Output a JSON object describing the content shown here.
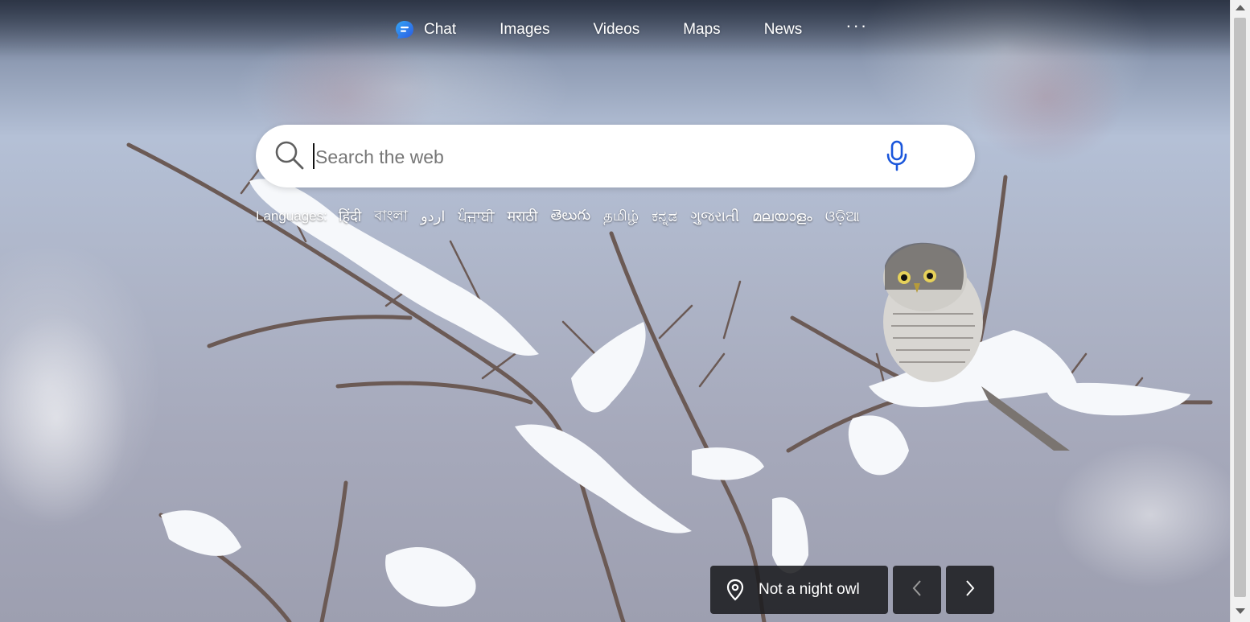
{
  "nav": {
    "items": [
      {
        "label": "Chat",
        "icon": "chat-icon"
      },
      {
        "label": "Images"
      },
      {
        "label": "Videos"
      },
      {
        "label": "Maps"
      },
      {
        "label": "News"
      }
    ],
    "more_label": "···"
  },
  "search": {
    "placeholder": "Search the web",
    "value": "",
    "icon": "search-icon",
    "voice_icon": "microphone-icon"
  },
  "languages": {
    "label": "Languages:",
    "items": [
      "हिंदी",
      "বাংলা",
      "اردو",
      "ਪੰਜਾਬੀ",
      "मराठी",
      "తెలుగు",
      "தமிழ்",
      "ಕನ್ನಡ",
      "ગુજરાતી",
      "മലയാളം",
      "ଓଡ଼ିଆ"
    ]
  },
  "image_info": {
    "title": "Not a night owl",
    "icon": "location-pin-icon",
    "prev_icon": "chevron-left-icon",
    "next_icon": "chevron-right-icon"
  },
  "colors": {
    "mic": "#1a56db",
    "panel": "#1c1c20",
    "chat_icon": "#2b7de9"
  }
}
